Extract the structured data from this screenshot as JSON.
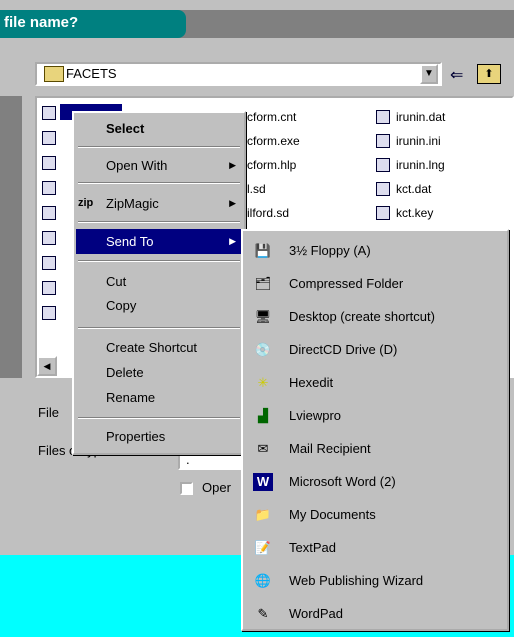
{
  "dialog": {
    "title": "file name?",
    "look_in": "FACETS",
    "file_name_label": "File",
    "files_of_type_label": "Files of type:",
    "open_readonly_label": "Oper",
    "files_of_type_value": "."
  },
  "files": {
    "col1": [
      "cform.cnt",
      "cform.exe",
      "cform.hlp",
      "l.sd",
      "ilford.sd"
    ],
    "col2": [
      "irunin.dat",
      "irunin.ini",
      "irunin.lng",
      "kct.dat",
      "kct.key"
    ]
  },
  "context_menu": {
    "select": "Select",
    "open_with": "Open With",
    "zipmagic": "ZipMagic",
    "send_to": "Send To",
    "cut": "Cut",
    "copy": "Copy",
    "create_shortcut": "Create Shortcut",
    "delete": "Delete",
    "rename": "Rename",
    "properties": "Properties",
    "zip_badge": "zip"
  },
  "send_to_menu": [
    {
      "label": "3½ Floppy (A)",
      "icon": "floppy-icon"
    },
    {
      "label": "Compressed Folder",
      "icon": "compressed-folder-icon"
    },
    {
      "label": "Desktop (create shortcut)",
      "icon": "desktop-icon"
    },
    {
      "label": "DirectCD Drive (D)",
      "icon": "cd-drive-icon"
    },
    {
      "label": "Hexedit",
      "icon": "hexedit-icon"
    },
    {
      "label": "Lviewpro",
      "icon": "lviewpro-icon"
    },
    {
      "label": "Mail Recipient",
      "icon": "mail-icon"
    },
    {
      "label": "Microsoft Word (2)",
      "icon": "word-icon"
    },
    {
      "label": "My Documents",
      "icon": "my-documents-icon"
    },
    {
      "label": "TextPad",
      "icon": "textpad-icon"
    },
    {
      "label": "Web Publishing Wizard",
      "icon": "web-publishing-icon"
    },
    {
      "label": "WordPad",
      "icon": "wordpad-icon"
    }
  ]
}
